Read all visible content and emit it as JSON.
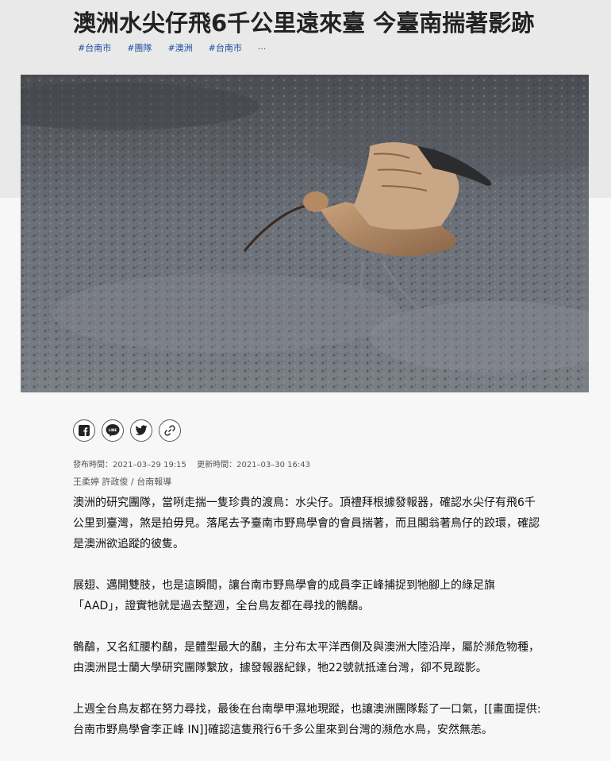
{
  "header": {
    "title": "澳洲水尖仔飛6千公里遠來臺 今臺南揣著影跡",
    "tags": [
      "#台南市",
      "#團隊",
      "#澳洲",
      "#台南市",
      "..."
    ]
  },
  "hero": {
    "icon": "curlew-photo"
  },
  "share": {
    "buttons": [
      "facebook-icon",
      "line-icon",
      "twitter-icon",
      "link-icon"
    ],
    "line_text": "LINE"
  },
  "meta": {
    "published": "發布時間：2021–03–29 19:15",
    "updated": "更新時間：2021–03–30 16:43",
    "authors": "王柔婷  許政俊  /  台南報導"
  },
  "article": {
    "paragraphs": [
      "澳洲的研究團隊，當咧走揣一隻珍貴的渡鳥：水尖仔。頂禮拜根據發報器，確認水尖仔有飛6千公里到臺灣，煞是拍毋見。落尾去予臺南市野鳥學會的會員揣著，而且閣翁著鳥仔的跤環，確認是澳洲欲追蹤的彼隻。",
      "展翅、邁開雙肢，也是這瞬間，讓台南市野鳥學會的成員李正峰捕捉到牠腳上的綠足旗「AAD」，證實牠就是過去整週，全台鳥友都在尋找的鶻鷸。",
      "鶻鷸，又名紅腰杓鷸，是體型最大的鷸，主分布太平洋西側及與澳洲大陸沿岸，屬於瀕危物種，由澳洲昆士蘭大學研究團隊繫放，據發報器紀錄，牠22號就抵達台灣，卻不見蹤影。",
      "上週全台鳥友都在努力尋找，最後在台南學甲濕地現蹤，也讓澳洲團隊鬆了一口氣，[[畫面提供:台南市野鳥學會李正峰 IN]]確認這隻飛行6千多公里來到台灣的瀕危水鳥，安然無恙。"
    ]
  }
}
